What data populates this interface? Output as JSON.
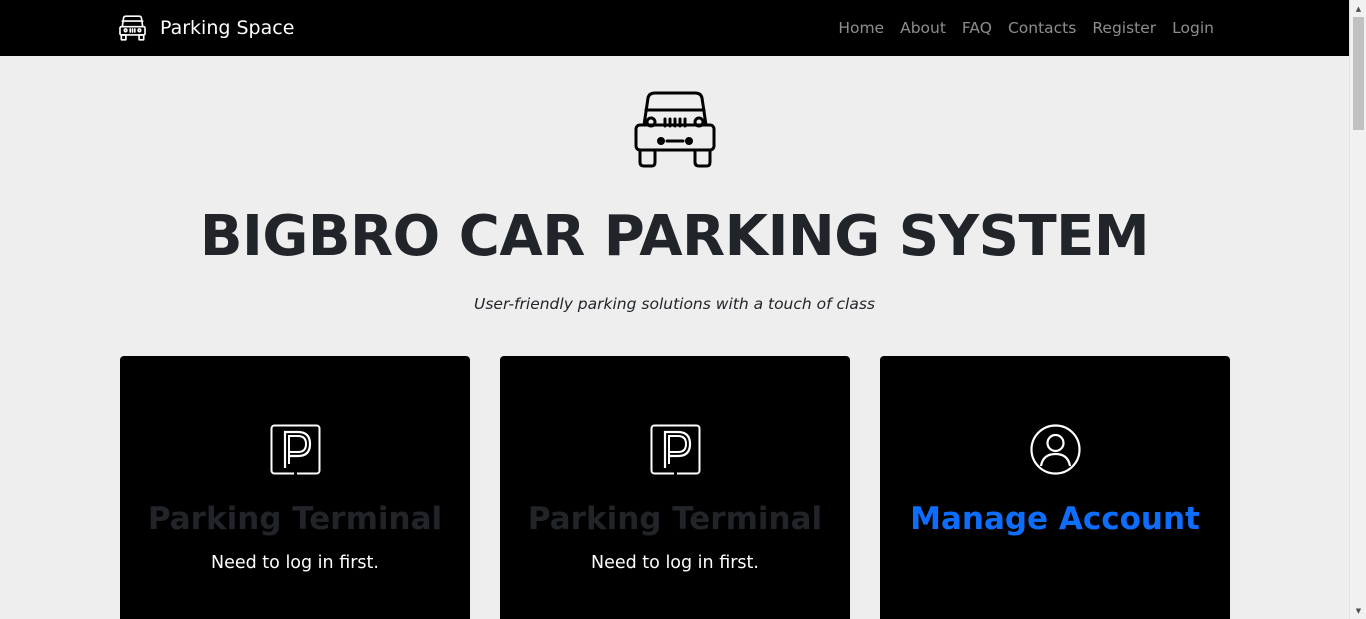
{
  "navbar": {
    "brand": "Parking Space",
    "links": [
      "Home",
      "About",
      "FAQ",
      "Contacts",
      "Register",
      "Login"
    ]
  },
  "hero": {
    "icon": "jeep-icon",
    "title": "BIGBRO CAR PARKING SYSTEM",
    "subtitle": "User-friendly parking solutions with a touch of class"
  },
  "cards": [
    {
      "icon": "parking-icon",
      "title": "Parking Terminal",
      "text": "Need to log in first."
    },
    {
      "icon": "parking-icon",
      "title": "Parking Terminal",
      "text": "Need to log in first."
    },
    {
      "icon": "user-circle-icon",
      "title": "Manage Account",
      "text": ""
    }
  ],
  "colors": {
    "navbar_bg": "#000000",
    "page_bg": "#eeeeee",
    "card_bg": "#000000",
    "link_accent": "#0d6efd",
    "disabled_title": "#212529"
  }
}
